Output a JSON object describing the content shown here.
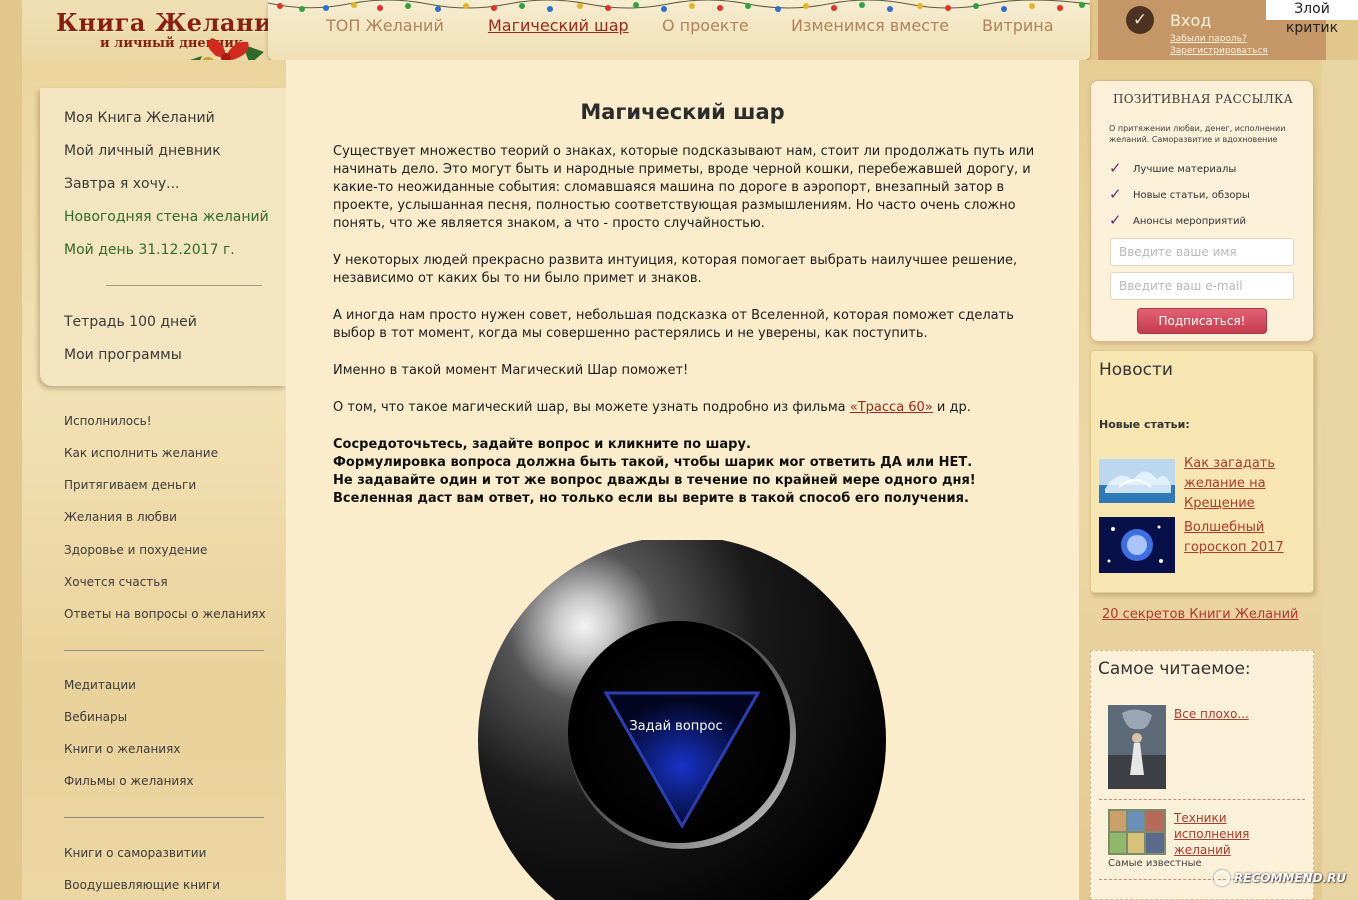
{
  "logo": {
    "title": "Книга Желаний",
    "subtitle": "и личный дневник"
  },
  "nav": {
    "items": [
      "ТОП Желаний",
      "Магический шар",
      "О проекте",
      "Изменимся вместе",
      "Витрина"
    ],
    "active_index": 1
  },
  "login": {
    "label": "Вход",
    "forgot": "Забыли пароль?",
    "register": "Зарегистрироваться"
  },
  "corner_label": "Злой критик",
  "left_panel": {
    "items": [
      "Моя Книга Желаний",
      "Мой личный дневник",
      "Завтра я хочу...",
      "Новогодняя стена желаний",
      "Мой день 31.12.2017 г.",
      "Тетрадь 100 дней",
      "Мои программы"
    ]
  },
  "left_sidebar": {
    "group1": [
      "Исполнилось!",
      "Как исполнить желание",
      "Притягиваем деньги",
      "Желания в любви",
      "Здоровье и похудение",
      "Хочется счастья",
      "Ответы на вопросы о желаниях"
    ],
    "group2": [
      "Медитации",
      "Вебинары",
      "Книги о желаниях",
      "Фильмы о желаниях"
    ],
    "group3": [
      "Книги о саморазвитии",
      "Воодушевляющие книги"
    ]
  },
  "main": {
    "title": "Магический шар",
    "p1": "Существует множество теорий о знаках, которые подсказывают нам, стоит ли продолжать путь или начинать дело. Это могут быть и народные приметы, вроде черной кошки, перебежавшей дорогу, и какие-то неожиданные события: сломавшаяся машина по дороге в аэропорт, внезапный затор в проекте, услышанная песня, полностью соответствующая размышлениям. Но часто очень сложно понять, что же является знаком, а что - просто случайностью.",
    "p2": "У некоторых людей прекрасно развита интуиция, которая помогает выбрать наилучшее решение, независимо от каких бы то ни было примет и знаков.",
    "p3": "А иногда нам просто нужен совет, небольшая подсказка от Вселенной, которая поможет сделать выбор в тот момент, когда мы совершенно растерялись и не уверены, как поступить.",
    "p4": "Именно в такой момент Магический Шар поможет!",
    "p5_before": "О том, что такое магический шар, вы можете узнать подробно из фильма ",
    "p5_link": "«Трасса 60»",
    "p5_after": " и др.",
    "instructions": [
      "Сосредоточьтесь, задайте вопрос и кликните по шару.",
      "Формулировка вопроса должна быть такой, чтобы шарик мог ответить ДА или НЕТ.",
      "Не задавайте один и тот же вопрос дважды в течение по крайней мере одного дня!",
      "Вселенная даст вам ответ, но только если вы верите в такой способ его получения."
    ],
    "ball_text": "Задай вопрос"
  },
  "subscribe": {
    "title": "ПОЗИТИВНАЯ РАССЫЛКА",
    "desc": "О притяжении любви, денег, исполнении желаний. Саморазвитие и вдохновение",
    "points": [
      "Лучшие материалы",
      "Новые статьи, обзоры",
      "Анонсы мероприятий"
    ],
    "name_placeholder": "Введите ваше имя",
    "email_placeholder": "Введите ваш e-mail",
    "button": "Подписаться!"
  },
  "news": {
    "title": "Новости",
    "subtitle": "Новые статьи:",
    "items": [
      "Как загадать желание на Крещение",
      "Волшебный гороскоп 2017"
    ]
  },
  "secrets_link": "20 секретов Книги Желаний",
  "popular": {
    "title": "Самое читаемое:",
    "items": [
      "Все плохо...",
      "Техники исполнения желаний"
    ],
    "note": "Самые известные"
  },
  "watermark": "RECOMMEND.RU",
  "colors": {
    "accent_red": "#a0281c",
    "link": "#b03a2e",
    "green": "#2f6b2a",
    "button": "#c43c4e",
    "content_bg": "#fbedcc"
  }
}
